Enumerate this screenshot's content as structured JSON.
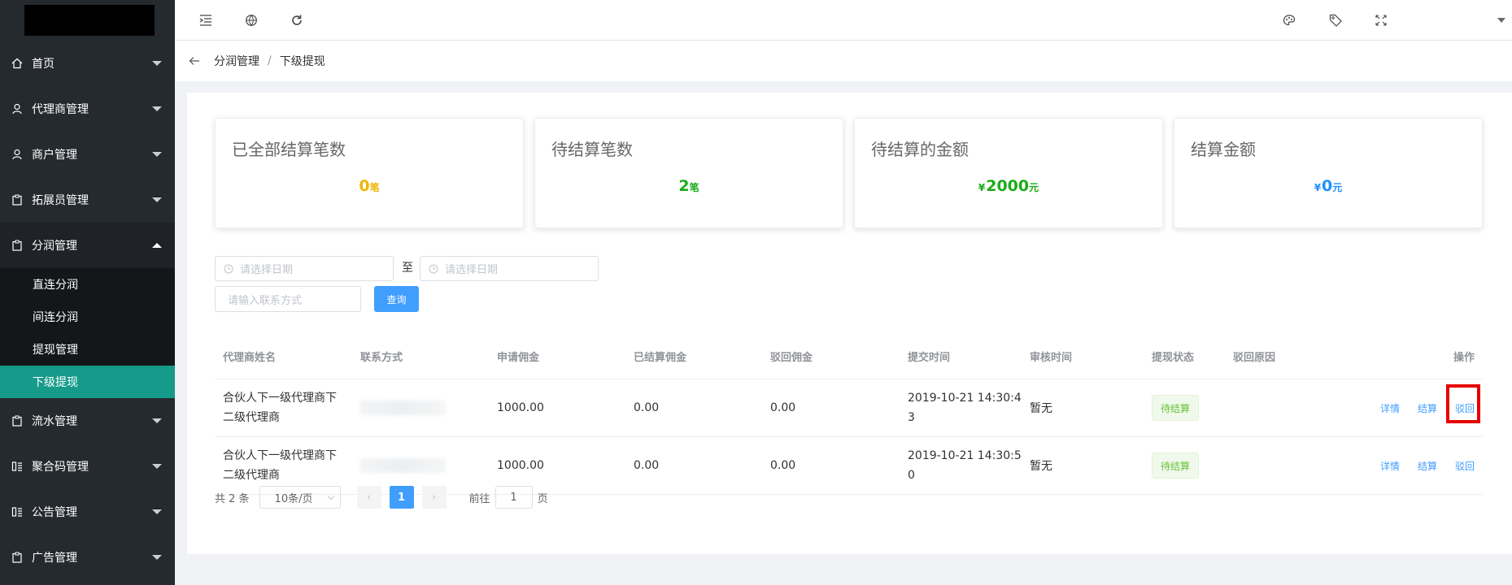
{
  "sidebar": {
    "menu": [
      {
        "label": "首页",
        "icon": "home-icon"
      },
      {
        "label": "代理商管理",
        "icon": "user-icon"
      },
      {
        "label": "商户管理",
        "icon": "user-icon"
      },
      {
        "label": "拓展员管理",
        "icon": "clipboard-icon"
      },
      {
        "label": "分润管理",
        "icon": "clipboard-icon"
      }
    ],
    "submenu": [
      "直连分润",
      "间连分润",
      "提现管理",
      "下级提现"
    ],
    "menu_bottom": [
      {
        "label": "流水管理",
        "icon": "clipboard-icon"
      },
      {
        "label": "聚合码管理",
        "icon": "qrcode-icon"
      },
      {
        "label": "公告管理",
        "icon": "qrcode-icon"
      },
      {
        "label": "广告管理",
        "icon": "clipboard-icon"
      }
    ]
  },
  "breadcrumb": {
    "parent": "分润管理",
    "separator": "/",
    "current": "下级提现"
  },
  "stats": [
    {
      "title": "已全部结算笔数",
      "currency": "",
      "value": "0",
      "unit": "笔",
      "color": "#f0b400"
    },
    {
      "title": "待结算笔数",
      "currency": "",
      "value": "2",
      "unit": "笔",
      "color": "#1aad19"
    },
    {
      "title": "待结算的金额",
      "currency": "¥",
      "value": "2000",
      "unit": "元",
      "color": "#1aad19"
    },
    {
      "title": "结算金额",
      "currency": "¥",
      "value": "0",
      "unit": "元",
      "color": "#1e90ff"
    }
  ],
  "filters": {
    "start_placeholder": "请选择日期",
    "to_label": "至",
    "end_placeholder": "请选择日期",
    "contact_placeholder": "请输入联系方式",
    "query_label": "查询"
  },
  "table": {
    "headers": [
      "代理商姓名",
      "联系方式",
      "申请佣金",
      "已结算佣金",
      "驳回佣金",
      "提交时间",
      "审核时间",
      "提现状态",
      "驳回原因",
      "操作"
    ],
    "rows": [
      {
        "name_line1": "合伙人下一级代理商下",
        "name_line2": "二级代理商",
        "apply": "1000.00",
        "settled": "0.00",
        "rejected": "0.00",
        "submit_line1": "2019-10-21 14:30:4",
        "submit_line2": "3",
        "audit": "暂无",
        "status": "待结算",
        "reason": ""
      },
      {
        "name_line1": "合伙人下一级代理商下",
        "name_line2": "二级代理商",
        "apply": "1000.00",
        "settled": "0.00",
        "rejected": "0.00",
        "submit_line1": "2019-10-21 14:30:5",
        "submit_line2": "0",
        "audit": "暂无",
        "status": "待结算",
        "reason": ""
      }
    ],
    "actions": {
      "detail": "详情",
      "settle": "结算",
      "reject": "驳回"
    }
  },
  "pagination": {
    "total_text": "共 2 条",
    "page_size": "10条/页",
    "current_page": "1",
    "goto_label": "前往",
    "goto_value": "1",
    "page_suffix": "页"
  },
  "colors": {
    "sidebar_bg": "#252a2f",
    "active_item": "#169b8a",
    "primary": "#409eff",
    "highlight": "#e60000"
  }
}
